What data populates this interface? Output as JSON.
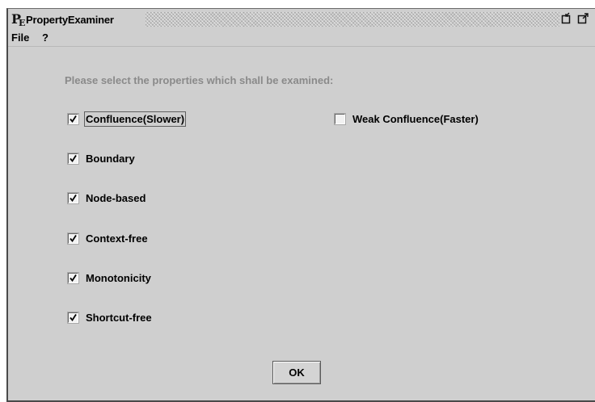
{
  "window": {
    "title": "PropertyExaminer",
    "icon": "PE-logo"
  },
  "menu": {
    "file": "File",
    "help": "?"
  },
  "instructions": "Please select the properties which shall be examined:",
  "checkboxes": {
    "confluence": {
      "label": "Confluence(Slower)",
      "checked": true
    },
    "weak_confluence": {
      "label": "Weak Confluence(Faster)",
      "checked": false
    },
    "boundary": {
      "label": "Boundary",
      "checked": true
    },
    "node_based": {
      "label": "Node-based",
      "checked": true
    },
    "context_free": {
      "label": "Context-free",
      "checked": true
    },
    "monotonicity": {
      "label": "Monotonicity",
      "checked": true
    },
    "shortcut_free": {
      "label": "Shortcut-free",
      "checked": true
    }
  },
  "buttons": {
    "ok": "OK"
  }
}
